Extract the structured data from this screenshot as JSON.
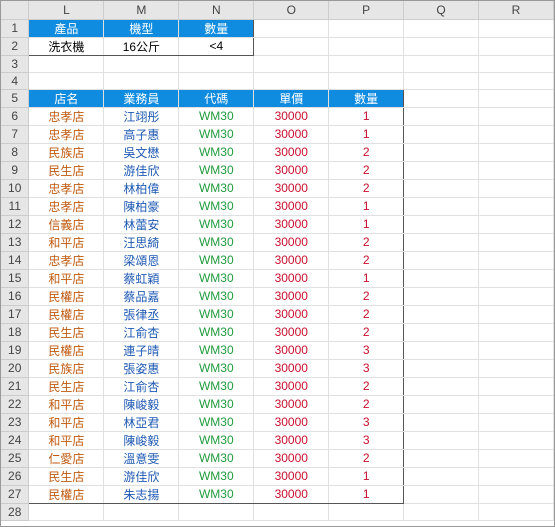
{
  "columns": [
    "L",
    "M",
    "N",
    "O",
    "P",
    "Q",
    "R"
  ],
  "row_numbers": [
    1,
    2,
    3,
    4,
    5,
    6,
    7,
    8,
    9,
    10,
    11,
    12,
    13,
    14,
    15,
    16,
    17,
    18,
    19,
    20,
    21,
    22,
    23,
    24,
    25,
    26,
    27,
    28
  ],
  "criteria_header": {
    "product": "產品",
    "model": "機型",
    "qty": "數量"
  },
  "criteria_row": {
    "product": "洗衣機",
    "model": "16公斤",
    "qty": "<4"
  },
  "table_header": {
    "store": "店名",
    "agent": "業務員",
    "code": "代碼",
    "price": "單價",
    "qty": "數量"
  },
  "chart_data": {
    "type": "table",
    "columns": [
      "店名",
      "業務員",
      "代碼",
      "單價",
      "數量"
    ],
    "rows": [
      [
        "忠孝店",
        "江翊彤",
        "WM30",
        "30000",
        "1"
      ],
      [
        "忠孝店",
        "高子惠",
        "WM30",
        "30000",
        "1"
      ],
      [
        "民族店",
        "吳文懋",
        "WM30",
        "30000",
        "2"
      ],
      [
        "民生店",
        "游佳欣",
        "WM30",
        "30000",
        "2"
      ],
      [
        "忠孝店",
        "林柏偉",
        "WM30",
        "30000",
        "2"
      ],
      [
        "忠孝店",
        "陳柏豪",
        "WM30",
        "30000",
        "1"
      ],
      [
        "信義店",
        "林蕾安",
        "WM30",
        "30000",
        "1"
      ],
      [
        "和平店",
        "汪思綺",
        "WM30",
        "30000",
        "2"
      ],
      [
        "忠孝店",
        "梁頌恩",
        "WM30",
        "30000",
        "2"
      ],
      [
        "和平店",
        "蔡虹穎",
        "WM30",
        "30000",
        "1"
      ],
      [
        "民權店",
        "蔡品嘉",
        "WM30",
        "30000",
        "2"
      ],
      [
        "民權店",
        "張律丞",
        "WM30",
        "30000",
        "2"
      ],
      [
        "民生店",
        "江俞杏",
        "WM30",
        "30000",
        "2"
      ],
      [
        "民權店",
        "連子晴",
        "WM30",
        "30000",
        "3"
      ],
      [
        "民族店",
        "張姿惠",
        "WM30",
        "30000",
        "3"
      ],
      [
        "民生店",
        "江俞杏",
        "WM30",
        "30000",
        "2"
      ],
      [
        "和平店",
        "陳峻毅",
        "WM30",
        "30000",
        "2"
      ],
      [
        "和平店",
        "林亞君",
        "WM30",
        "30000",
        "3"
      ],
      [
        "和平店",
        "陳峻毅",
        "WM30",
        "30000",
        "3"
      ],
      [
        "仁愛店",
        "溫意雯",
        "WM30",
        "30000",
        "2"
      ],
      [
        "民生店",
        "游佳欣",
        "WM30",
        "30000",
        "1"
      ],
      [
        "民權店",
        "朱志揚",
        "WM30",
        "30000",
        "1"
      ]
    ]
  }
}
